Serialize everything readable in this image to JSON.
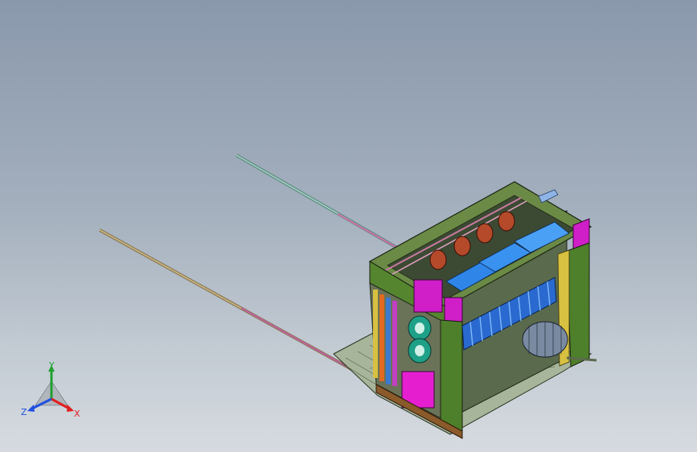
{
  "triad": {
    "x_label": "X",
    "y_label": "Y",
    "z_label": "Z",
    "x_color": "#e02020",
    "y_color": "#20a030",
    "z_color": "#2050e0"
  },
  "model": {
    "frame_color": "#4f8a2c",
    "accent_magenta": "#d01ec8",
    "accent_blue": "#2f86e8",
    "rod_colors": [
      "#7aa8a0",
      "#b8a070",
      "#d080b0"
    ]
  }
}
